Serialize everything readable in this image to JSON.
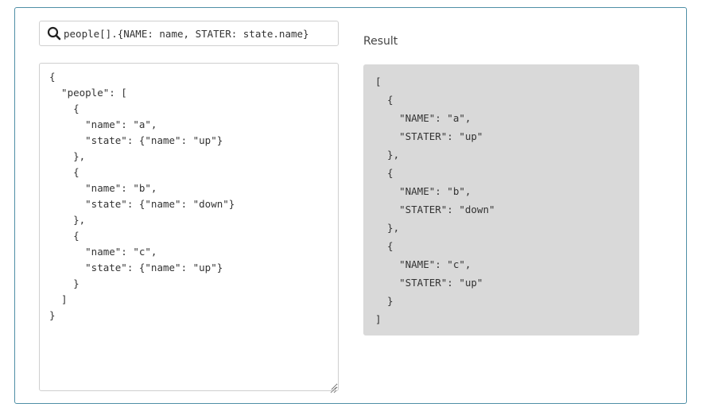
{
  "query": {
    "value": "people[].{NAME: name, STATER: state.name}",
    "icon": "search-icon"
  },
  "input_json": "{\n  \"people\": [\n    {\n      \"name\": \"a\",\n      \"state\": {\"name\": \"up\"}\n    },\n    {\n      \"name\": \"b\",\n      \"state\": {\"name\": \"down\"}\n    },\n    {\n      \"name\": \"c\",\n      \"state\": {\"name\": \"up\"}\n    }\n  ]\n}",
  "result": {
    "label": "Result",
    "output": "[\n  {\n    \"NAME\": \"a\",\n    \"STATER\": \"up\"\n  },\n  {\n    \"NAME\": \"b\",\n    \"STATER\": \"down\"\n  },\n  {\n    \"NAME\": \"c\",\n    \"STATER\": \"up\"\n  }\n]"
  },
  "colors": {
    "panel_border": "#4f8fa6",
    "result_background": "#d9d9d9",
    "input_border": "#cfcfcf",
    "text": "#333333"
  }
}
